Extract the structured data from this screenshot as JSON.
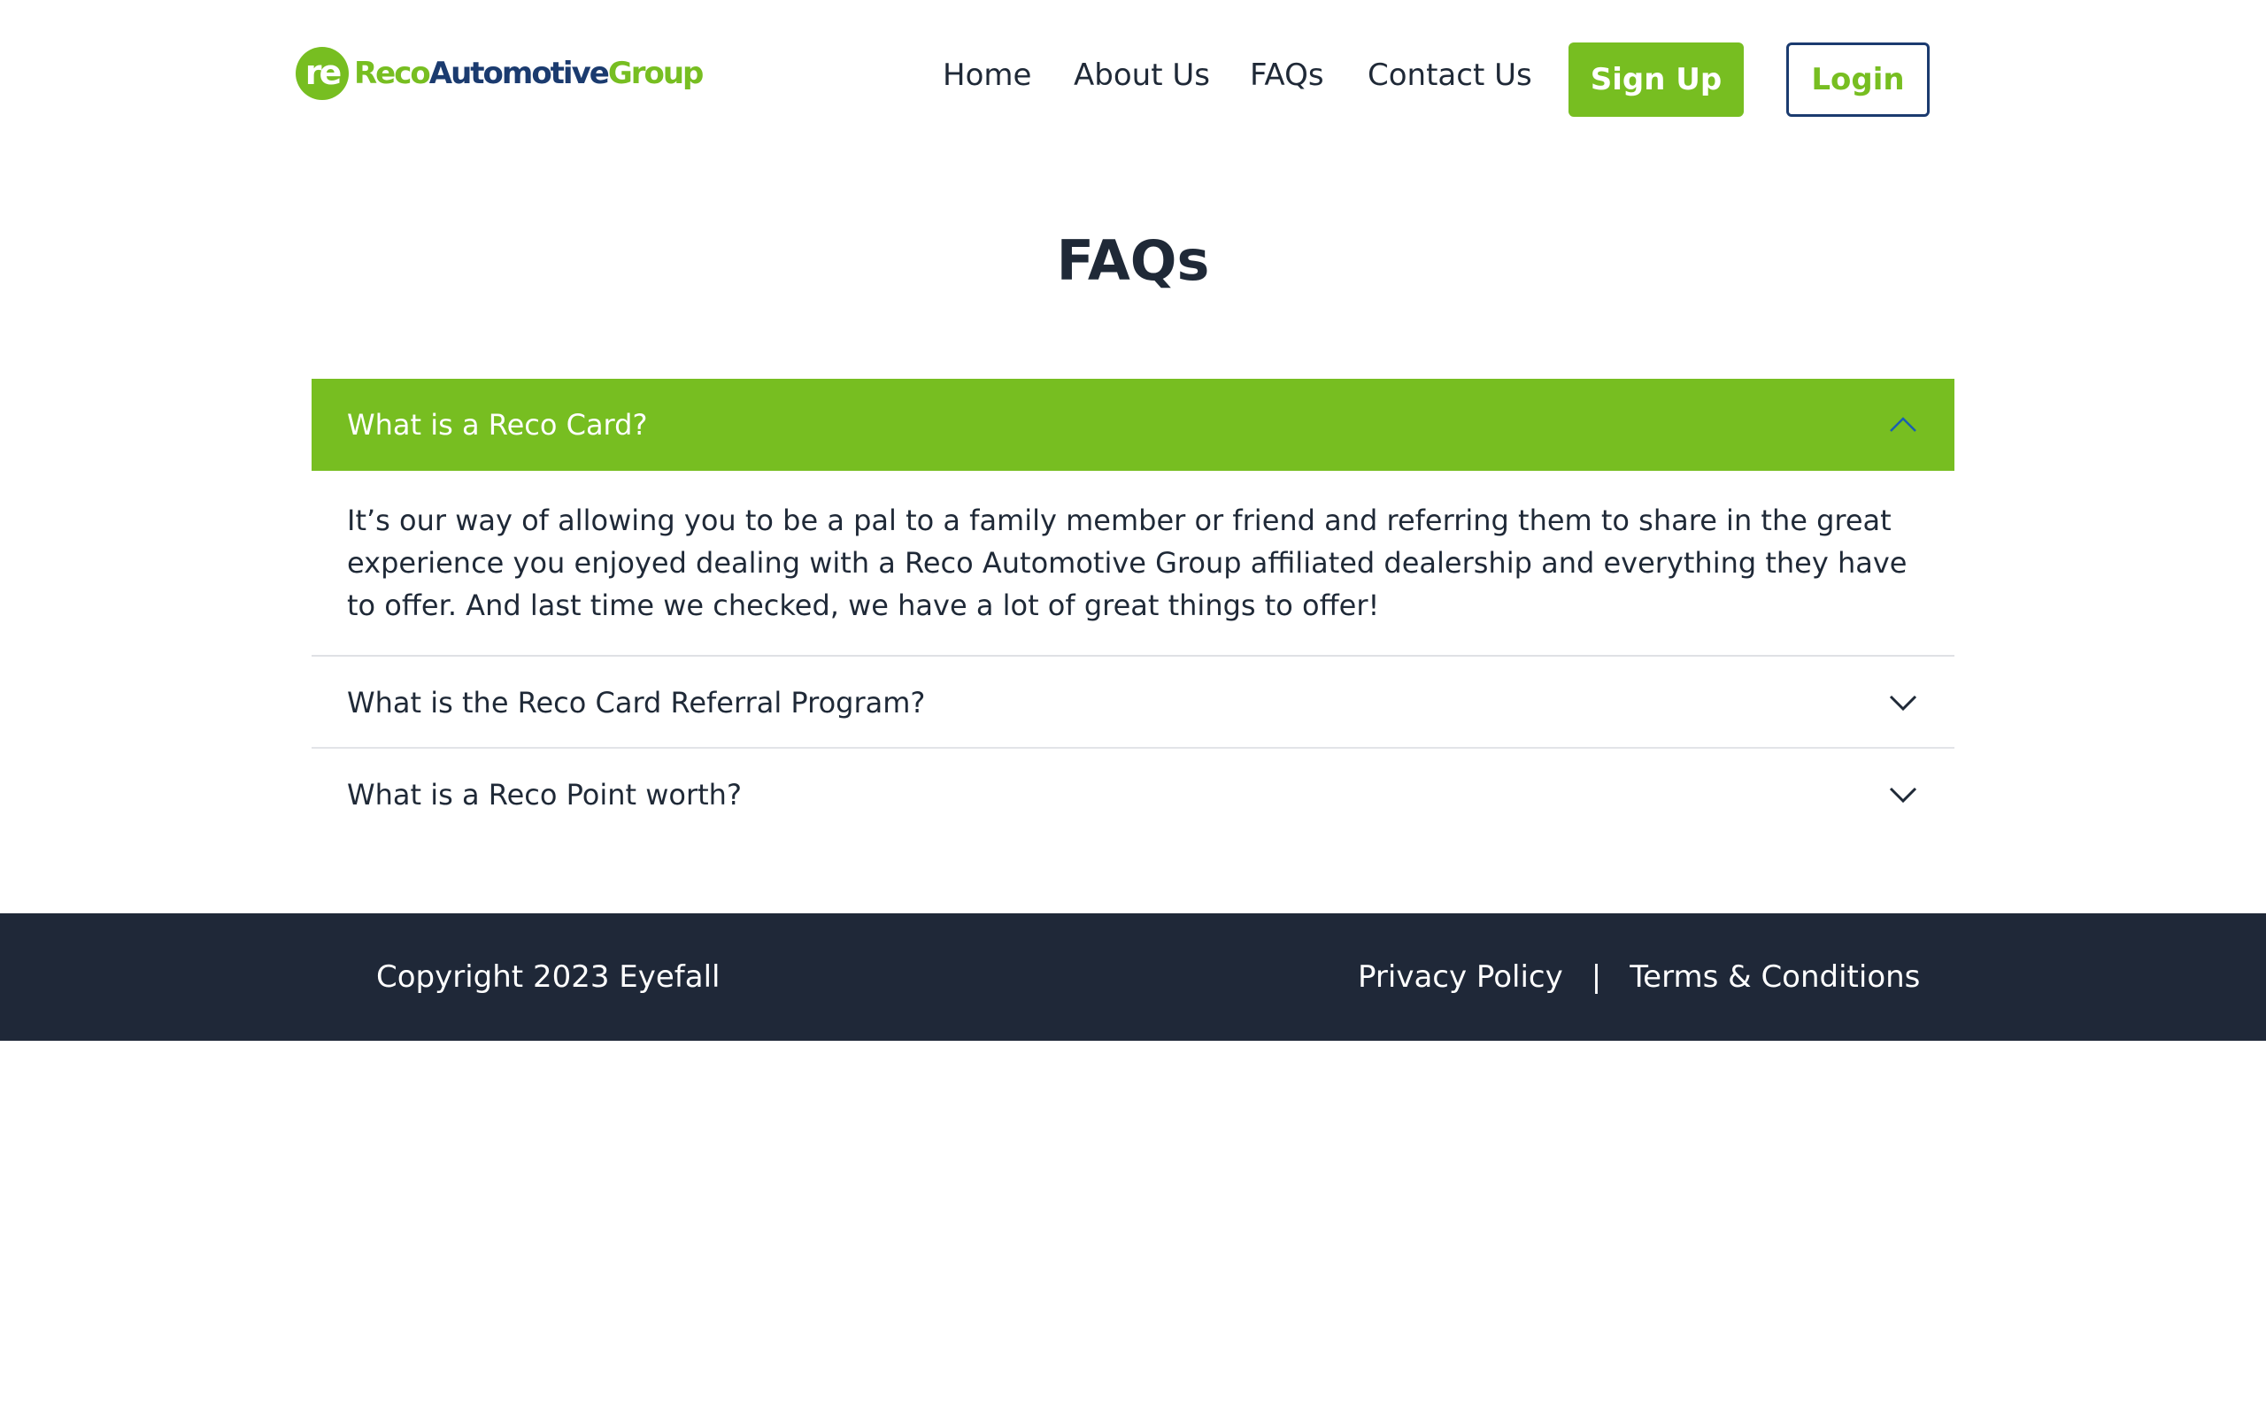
{
  "brand": {
    "badge": "re",
    "name_part1": "Reco",
    "name_part2": "Automotive",
    "name_part3": "Group",
    "primary_color": "#77be21",
    "secondary_color": "#1b3b6f"
  },
  "nav": {
    "items": [
      {
        "label": "Home"
      },
      {
        "label": "About Us"
      },
      {
        "label": "FAQs"
      },
      {
        "label": "Contact Us"
      }
    ],
    "signup_label": "Sign Up",
    "login_label": "Login"
  },
  "page": {
    "title": "FAQs"
  },
  "faq": {
    "items": [
      {
        "question": "What is a Reco Card?",
        "answer": "It’s our way of allowing you to be a pal to a family member or friend and referring them to share in the great experience you enjoyed dealing with a Reco Automotive Group affiliated dealership and everything they have to offer. And last time we checked, we have a lot of great things to offer!",
        "expanded": true,
        "icon": "chevron-up-icon"
      },
      {
        "question": "What is the Reco Card Referral Program?",
        "expanded": false,
        "icon": "chevron-down-icon"
      },
      {
        "question": "What is a Reco Point worth?",
        "expanded": false,
        "icon": "chevron-down-icon"
      }
    ]
  },
  "footer": {
    "copyright": "Copyright 2023 Eyefall",
    "privacy_label": "Privacy Policy",
    "separator": "|",
    "terms_label": "Terms & Conditions",
    "background": "#1f2838"
  }
}
